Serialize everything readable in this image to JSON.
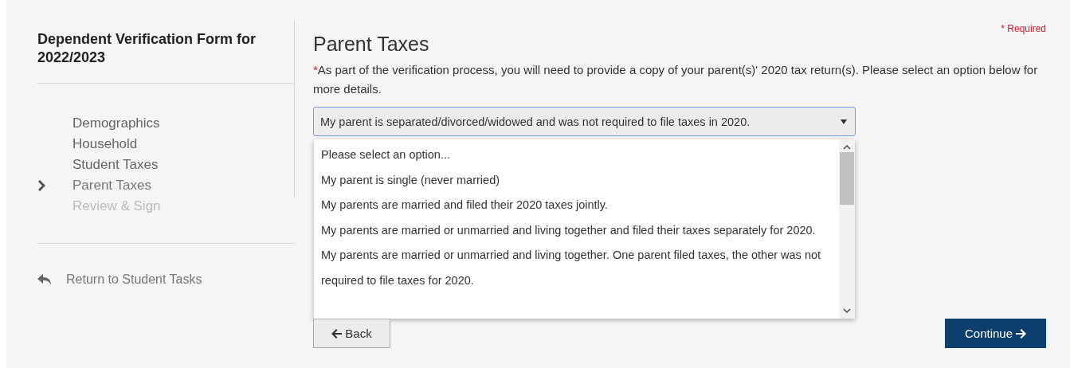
{
  "sidebar": {
    "title": "Dependent Verification Form for 2022/2023",
    "steps": [
      {
        "label": "Demographics",
        "current": false,
        "disabled": false
      },
      {
        "label": "Household",
        "current": false,
        "disabled": false
      },
      {
        "label": "Student Taxes",
        "current": false,
        "disabled": false
      },
      {
        "label": "Parent Taxes",
        "current": true,
        "disabled": false
      },
      {
        "label": "Review & Sign",
        "current": false,
        "disabled": true
      }
    ],
    "return_link": "Return to Student Tasks"
  },
  "main": {
    "heading": "Parent Taxes",
    "required_note": "* Required",
    "required_mark": "*",
    "instructions": "As part of the verification process, you will need to provide a copy of your parent(s)' 2020 tax return(s). Please select an option below for more details.",
    "select": {
      "value": "My parent is separated/divorced/widowed and was not required to file taxes in 2020.",
      "expanded": true,
      "options": [
        {
          "label": "Please select an option...",
          "selected": false
        },
        {
          "label": "My parent is single (never married)",
          "selected": false
        },
        {
          "label": "My parents are married and filed their 2020 taxes jointly.",
          "selected": false
        },
        {
          "label": "My parents are married or unmarried and living together and filed their taxes separately for 2020.",
          "selected": false
        },
        {
          "label": "My parents are married or unmarried and living together. One parent filed taxes, the other was not required to file taxes for 2020.",
          "selected": false
        }
      ]
    },
    "buttons": {
      "back": "Back",
      "continue": "Continue"
    }
  }
}
